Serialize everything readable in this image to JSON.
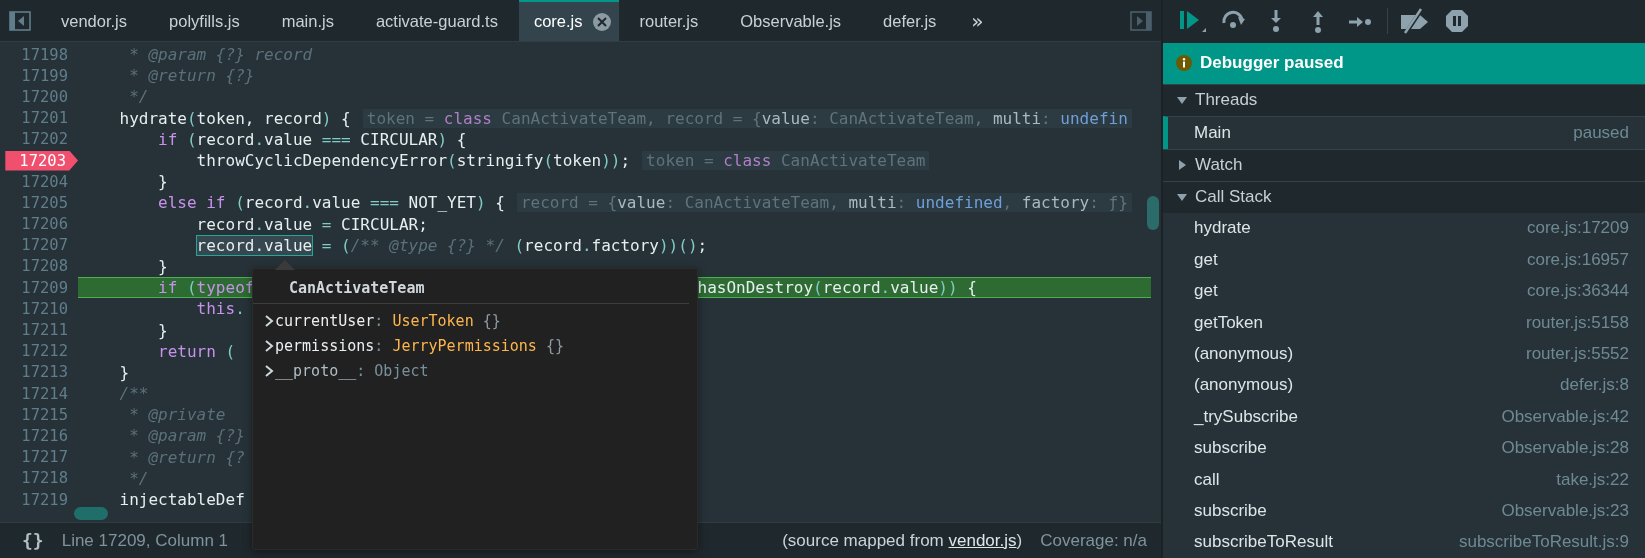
{
  "editor": {
    "tabs": [
      {
        "label": "vendor.js",
        "selected": false
      },
      {
        "label": "polyfills.js",
        "selected": false
      },
      {
        "label": "main.js",
        "selected": false
      },
      {
        "label": "activate-guard.ts",
        "selected": false
      },
      {
        "label": "core.js",
        "selected": true
      },
      {
        "label": "router.js",
        "selected": false
      },
      {
        "label": "Observable.js",
        "selected": false
      },
      {
        "label": "defer.js",
        "selected": false
      }
    ],
    "tab_overflow": "»",
    "lines": [
      {
        "number": "17198",
        "breakpoint": false,
        "current": false,
        "code": [
          {
            "text": "     * @param {?} record",
            "kind": "comment"
          }
        ]
      },
      {
        "number": "17199",
        "breakpoint": false,
        "current": false,
        "code": [
          {
            "text": "     * @return {?}",
            "kind": "comment"
          }
        ]
      },
      {
        "number": "17200",
        "breakpoint": false,
        "current": false,
        "code": [
          {
            "text": "     */",
            "kind": "comment"
          }
        ]
      },
      {
        "number": "17201",
        "breakpoint": false,
        "current": false,
        "code": [
          {
            "text": "    hydrate",
            "kind": "plain"
          },
          {
            "text": "(",
            "kind": "punct"
          },
          {
            "text": "token, record",
            "kind": "plain"
          },
          {
            "text": ")",
            "kind": "punct"
          },
          {
            "text": " {",
            "kind": "plain"
          }
        ],
        "hint": [
          {
            "text": "token = ",
            "kind": "muted"
          },
          {
            "text": "class",
            "kind": "keyword"
          },
          {
            "text": " CanActivateTeam, record = {",
            "kind": "muted"
          },
          {
            "text": "value",
            "kind": "key"
          },
          {
            "text": ": CanActivateTeam, ",
            "kind": "muted"
          },
          {
            "text": "multi",
            "kind": "key"
          },
          {
            "text": ": ",
            "kind": "muted"
          },
          {
            "text": "undefin",
            "kind": "literal"
          }
        ]
      },
      {
        "number": "17202",
        "breakpoint": false,
        "current": false,
        "code": [
          {
            "text": "        if",
            "kind": "keyword"
          },
          {
            "text": " (",
            "kind": "punct"
          },
          {
            "text": "record",
            "kind": "plain"
          },
          {
            "text": ".",
            "kind": "punct"
          },
          {
            "text": "value",
            "kind": "plain"
          },
          {
            "text": " ===",
            "kind": "punct"
          },
          {
            "text": " CIRCULAR",
            "kind": "plain"
          },
          {
            "text": ")",
            "kind": "punct"
          },
          {
            "text": " {",
            "kind": "plain"
          }
        ]
      },
      {
        "number": "17203",
        "breakpoint": true,
        "current": false,
        "code": [
          {
            "text": "            throwCyclicDependencyError",
            "kind": "plain"
          },
          {
            "text": "(",
            "kind": "punct"
          },
          {
            "text": "stringify",
            "kind": "plain"
          },
          {
            "text": "(",
            "kind": "punct"
          },
          {
            "text": "token",
            "kind": "plain"
          },
          {
            "text": "))",
            "kind": "punct"
          },
          {
            "text": ";",
            "kind": "plain"
          }
        ],
        "hint": [
          {
            "text": "token = ",
            "kind": "muted"
          },
          {
            "text": "class",
            "kind": "keyword"
          },
          {
            "text": " CanActivateTeam",
            "kind": "muted"
          }
        ]
      },
      {
        "number": "17204",
        "breakpoint": false,
        "current": false,
        "code": [
          {
            "text": "        }",
            "kind": "plain"
          }
        ]
      },
      {
        "number": "17205",
        "breakpoint": false,
        "current": false,
        "code": [
          {
            "text": "        else if",
            "kind": "keyword"
          },
          {
            "text": " (",
            "kind": "punct"
          },
          {
            "text": "record",
            "kind": "plain"
          },
          {
            "text": ".",
            "kind": "punct"
          },
          {
            "text": "value",
            "kind": "plain"
          },
          {
            "text": " ===",
            "kind": "punct"
          },
          {
            "text": " NOT_YET",
            "kind": "plain"
          },
          {
            "text": ")",
            "kind": "punct"
          },
          {
            "text": " {",
            "kind": "plain"
          }
        ],
        "hint": [
          {
            "text": "record = {",
            "kind": "muted"
          },
          {
            "text": "value",
            "kind": "key"
          },
          {
            "text": ": CanActivateTeam, ",
            "kind": "muted"
          },
          {
            "text": "multi",
            "kind": "key"
          },
          {
            "text": ": ",
            "kind": "muted"
          },
          {
            "text": "undefined",
            "kind": "literal"
          },
          {
            "text": ", ",
            "kind": "muted"
          },
          {
            "text": "factory",
            "kind": "key"
          },
          {
            "text": ": ƒ}",
            "kind": "muted"
          }
        ]
      },
      {
        "number": "17206",
        "breakpoint": false,
        "current": false,
        "code": [
          {
            "text": "            record",
            "kind": "plain"
          },
          {
            "text": ".",
            "kind": "punct"
          },
          {
            "text": "value",
            "kind": "plain"
          },
          {
            "text": " =",
            "kind": "punct"
          },
          {
            "text": " CIRCULAR;",
            "kind": "plain"
          }
        ]
      },
      {
        "number": "17207",
        "breakpoint": false,
        "current": false,
        "code": [
          {
            "text": "            record.value",
            "kind": "selection"
          },
          {
            "text": " = (",
            "kind": "punct"
          },
          {
            "text": "/** @type {?} */",
            "kind": "comment"
          },
          {
            "text": " (",
            "kind": "punct"
          },
          {
            "text": "record",
            "kind": "plain"
          },
          {
            "text": ".",
            "kind": "punct"
          },
          {
            "text": "factory",
            "kind": "plain"
          },
          {
            "text": "))()",
            "kind": "punct"
          },
          {
            "text": ";",
            "kind": "plain"
          }
        ]
      },
      {
        "number": "17208",
        "breakpoint": false,
        "current": false,
        "code": [
          {
            "text": "        }",
            "kind": "plain"
          }
        ]
      },
      {
        "number": "17209",
        "breakpoint": false,
        "current": true,
        "code": [
          {
            "text": "        if",
            "kind": "keyword"
          },
          {
            "text": " (",
            "kind": "punct"
          },
          {
            "text": "typeof",
            "kind": "keyword"
          }
        ],
        "tail": [
          {
            "text": "hasOnDestroy",
            "kind": "plain"
          },
          {
            "text": "(",
            "kind": "punct"
          },
          {
            "text": "record",
            "kind": "plain"
          },
          {
            "text": ".",
            "kind": "punct"
          },
          {
            "text": "value",
            "kind": "plain"
          },
          {
            "text": "))",
            "kind": "punct"
          },
          {
            "text": " {",
            "kind": "plain"
          }
        ]
      },
      {
        "number": "17210",
        "breakpoint": false,
        "current": false,
        "code": [
          {
            "text": "            this",
            "kind": "keyword"
          },
          {
            "text": ".",
            "kind": "punct"
          }
        ]
      },
      {
        "number": "17211",
        "breakpoint": false,
        "current": false,
        "code": [
          {
            "text": "        }",
            "kind": "plain"
          }
        ]
      },
      {
        "number": "17212",
        "breakpoint": false,
        "current": false,
        "code": [
          {
            "text": "        return",
            "kind": "keyword"
          },
          {
            "text": " (",
            "kind": "punct"
          }
        ]
      },
      {
        "number": "17213",
        "breakpoint": false,
        "current": false,
        "code": [
          {
            "text": "    }",
            "kind": "plain"
          }
        ]
      },
      {
        "number": "17214",
        "breakpoint": false,
        "current": false,
        "code": [
          {
            "text": "    /**",
            "kind": "comment"
          }
        ]
      },
      {
        "number": "17215",
        "breakpoint": false,
        "current": false,
        "code": [
          {
            "text": "     * @private",
            "kind": "comment"
          }
        ]
      },
      {
        "number": "17216",
        "breakpoint": false,
        "current": false,
        "code": [
          {
            "text": "     * @param {?}",
            "kind": "comment"
          }
        ]
      },
      {
        "number": "17217",
        "breakpoint": false,
        "current": false,
        "code": [
          {
            "text": "     * @return {?",
            "kind": "comment"
          }
        ]
      },
      {
        "number": "17218",
        "breakpoint": false,
        "current": false,
        "code": [
          {
            "text": "     */",
            "kind": "comment"
          }
        ]
      },
      {
        "number": "17219",
        "breakpoint": false,
        "current": false,
        "code": [
          {
            "text": "    injectableDef",
            "kind": "plain"
          }
        ]
      }
    ],
    "popup": {
      "title": "CanActivateTeam",
      "properties": [
        {
          "kind": "own",
          "key": "currentUser",
          "separator": ": ",
          "type": "UserToken",
          "suffix": "{}"
        },
        {
          "kind": "own",
          "key": "permissions",
          "separator": ": ",
          "type": "JerryPermissions",
          "suffix": "{}"
        },
        {
          "kind": "proto",
          "key": "__proto__",
          "separator": ": ",
          "type": "Object"
        }
      ]
    },
    "status_bar": {
      "format_button": "{}",
      "position": "Line 17209, Column 1",
      "source_prefix": "(source mapped from ",
      "source_link": "vendor.js",
      "source_suffix": ")",
      "coverage": "Coverage: n/a"
    }
  },
  "debugger": {
    "banner": "Debugger paused",
    "sections": [
      {
        "title": "Threads",
        "expanded": true,
        "items": [
          {
            "name": "Main",
            "status": "paused",
            "selected": true
          }
        ]
      },
      {
        "title": "Watch",
        "expanded": false
      },
      {
        "title": "Call Stack",
        "expanded": true,
        "frames": [
          {
            "name": "hydrate",
            "location": "core.js:17209"
          },
          {
            "name": "get",
            "location": "core.js:16957"
          },
          {
            "name": "get",
            "location": "core.js:36344"
          },
          {
            "name": "getToken",
            "location": "router.js:5158"
          },
          {
            "name": "(anonymous)",
            "location": "router.js:5552"
          },
          {
            "name": "(anonymous)",
            "location": "defer.js:8"
          },
          {
            "name": "_trySubscribe",
            "location": "Observable.js:42"
          },
          {
            "name": "subscribe",
            "location": "Observable.js:28"
          },
          {
            "name": "call",
            "location": "take.js:22"
          },
          {
            "name": "subscribe",
            "location": "Observable.js:23"
          },
          {
            "name": "subscribeToResult",
            "location": "subscribeToResult.js:9"
          }
        ]
      }
    ]
  }
}
